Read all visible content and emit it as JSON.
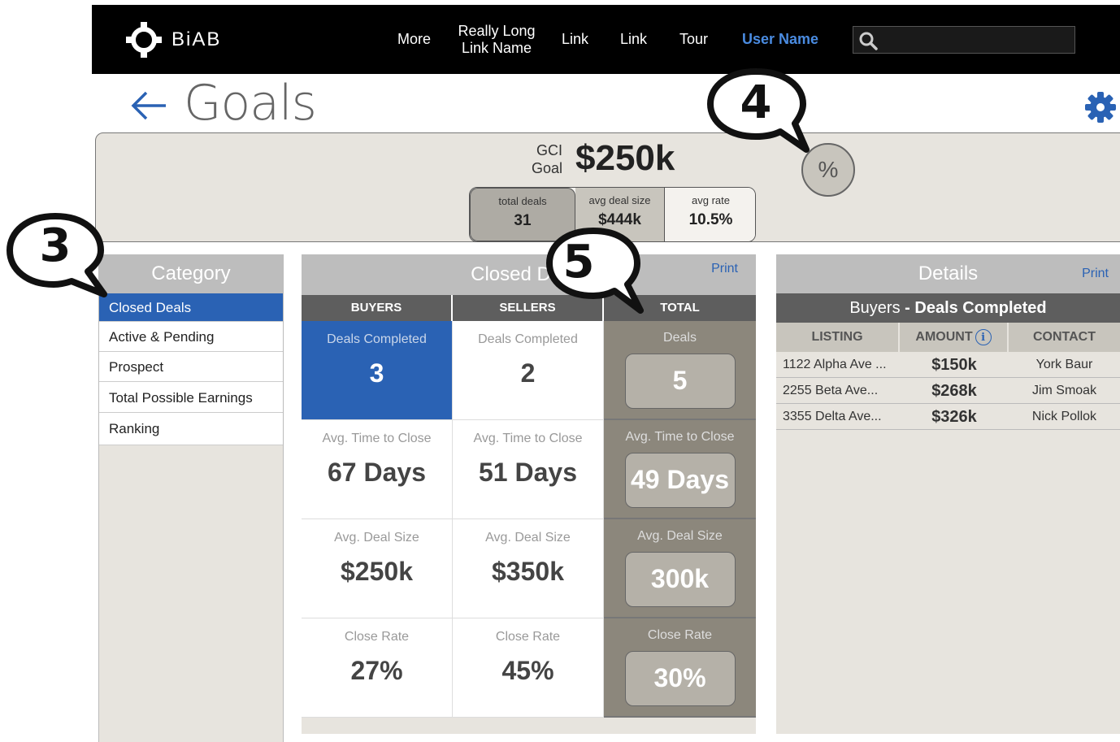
{
  "nav": {
    "brand": "BiAB",
    "links": [
      "More",
      "Really Long Link Name",
      "Link",
      "Link",
      "Tour"
    ],
    "user": "User Name",
    "search_placeholder": ""
  },
  "page": {
    "title": "Goals"
  },
  "summary": {
    "gci_label_1": "GCI",
    "gci_label_2": "Goal",
    "gci_value": "$250k",
    "stats": [
      {
        "label": "total deals",
        "value": "31"
      },
      {
        "label": "avg deal size",
        "value": "$444k"
      },
      {
        "label": "avg rate",
        "value": "10.5%"
      }
    ],
    "percent_button": "%"
  },
  "category": {
    "header": "Category",
    "items": [
      "Closed Deals",
      "Active & Pending",
      "Prospect",
      "Total Possible Earnings",
      "Ranking"
    ],
    "active_index": 0
  },
  "closed_deals": {
    "header": "Closed Deals",
    "print": "Print",
    "columns": [
      "BUYERS",
      "SELLERS",
      "TOTAL"
    ],
    "buyers": [
      {
        "label": "Deals Completed",
        "value": "3"
      },
      {
        "label": "Avg. Time to Close",
        "value": "67 Days"
      },
      {
        "label": "Avg. Deal Size",
        "value": "$250k"
      },
      {
        "label": "Close Rate",
        "value": "27%"
      }
    ],
    "sellers": [
      {
        "label": "Deals Completed",
        "value": "2"
      },
      {
        "label": "Avg. Time to Close",
        "value": "51 Days"
      },
      {
        "label": "Avg. Deal Size",
        "value": "$350k"
      },
      {
        "label": "Close Rate",
        "value": "45%"
      }
    ],
    "total": [
      {
        "label": "Deals",
        "value": "5"
      },
      {
        "label": "Avg. Time to Close",
        "value": "49 Days"
      },
      {
        "label": "Avg. Deal Size",
        "value": "300k"
      },
      {
        "label": "Close Rate",
        "value": "30%"
      }
    ]
  },
  "details": {
    "header": "Details",
    "print": "Print",
    "sub_prefix": "Buyers",
    "sub_bold": "- Deals Completed",
    "columns": [
      "LISTING",
      "AMOUNT",
      "CONTACT"
    ],
    "rows": [
      {
        "listing": "1122 Alpha Ave ...",
        "amount": "$150k",
        "contact": "York Baur"
      },
      {
        "listing": "2255 Beta Ave...",
        "amount": "$268k",
        "contact": "Jim Smoak"
      },
      {
        "listing": "3355 Delta Ave...",
        "amount": "$326k",
        "contact": "Nick Pollok"
      }
    ]
  },
  "callouts": [
    "3",
    "4",
    "5"
  ],
  "colors": {
    "accent_blue": "#2a62b4",
    "nav_bg": "#000000",
    "panel_bg": "#e7e4de",
    "total_bg": "#8c877c"
  },
  "icons": [
    "crosshair-logo-icon",
    "search-icon",
    "back-arrow-icon",
    "gear-icon",
    "info-icon"
  ]
}
